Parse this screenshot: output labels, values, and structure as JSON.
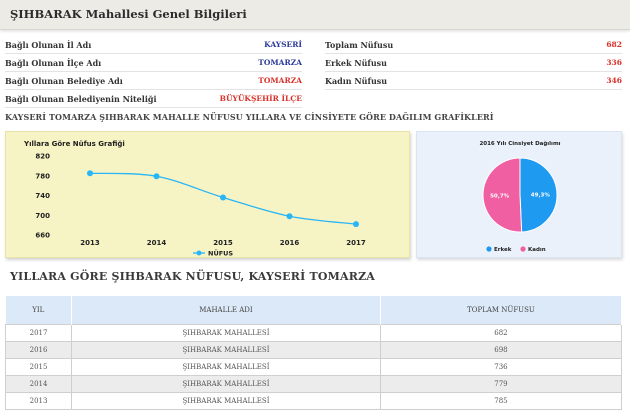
{
  "header": {
    "title": "ŞIHBARAK Mahallesi Genel Bilgileri"
  },
  "info_left": [
    {
      "label": "Bağlı Olunan İl Adı",
      "value": "KAYSERİ",
      "color": "#2a3a9a"
    },
    {
      "label": "Bağlı Olunan İlçe Adı",
      "value": "TOMARZA",
      "color": "#2a3a9a"
    },
    {
      "label": "Bağlı Olunan Belediye Adı",
      "value": "TOMARZA",
      "color": "#d9302a"
    },
    {
      "label": "Bağlı Olunan Belediyenin Niteliği",
      "value": "BÜYÜKŞEHİR İLÇE",
      "color": "#d9302a"
    }
  ],
  "info_right": [
    {
      "label": "Toplam Nüfusu",
      "value": "682",
      "color": "#d9302a"
    },
    {
      "label": "Erkek Nüfusu",
      "value": "336",
      "color": "#d9302a"
    },
    {
      "label": "Kadın Nüfusu",
      "value": "346",
      "color": "#d9302a"
    }
  ],
  "section_heading": "KAYSERİ TOMARZA ŞIHBARAK MAHALLE NÜFUSU YILLARA VE CİNSİYETE GÖRE DAĞILIM GRAFİKLERİ",
  "chart_data": [
    {
      "type": "line",
      "title": "Yıllara Göre Nüfus Grafiği",
      "categories": [
        "2013",
        "2014",
        "2015",
        "2016",
        "2017"
      ],
      "series": [
        {
          "name": "NÜFUS",
          "values": [
            785,
            779,
            736,
            698,
            682
          ],
          "color": "#29b6f6"
        }
      ],
      "ylim": [
        660,
        820
      ],
      "yticks": [
        660,
        700,
        740,
        780,
        820
      ],
      "legend": "bottom",
      "grid": false
    },
    {
      "type": "pie",
      "title": "2016 Yılı Cinsiyet Dağılımı",
      "slices": [
        {
          "name": "Erkek",
          "value": 49.3,
          "label": "49,3%",
          "color": "#1e9af0"
        },
        {
          "name": "Kadın",
          "value": 50.7,
          "label": "50,7%",
          "color": "#f05fa2"
        }
      ],
      "legend": "bottom"
    }
  ],
  "big_heading": "YILLARA GÖRE ŞIHBARAK NÜFUSU, KAYSERİ TOMARZA",
  "table": {
    "headers": [
      "YIL",
      "MAHALLE ADI",
      "TOPLAM NÜFUSU"
    ],
    "rows": [
      [
        "2017",
        "ŞIHBARAK MAHALLESİ",
        "682"
      ],
      [
        "2016",
        "ŞIHBARAK MAHALLESİ",
        "698"
      ],
      [
        "2015",
        "ŞIHBARAK MAHALLESİ",
        "736"
      ],
      [
        "2014",
        "ŞIHBARAK MAHALLESİ",
        "779"
      ],
      [
        "2013",
        "ŞIHBARAK MAHALLESİ",
        "785"
      ]
    ]
  }
}
